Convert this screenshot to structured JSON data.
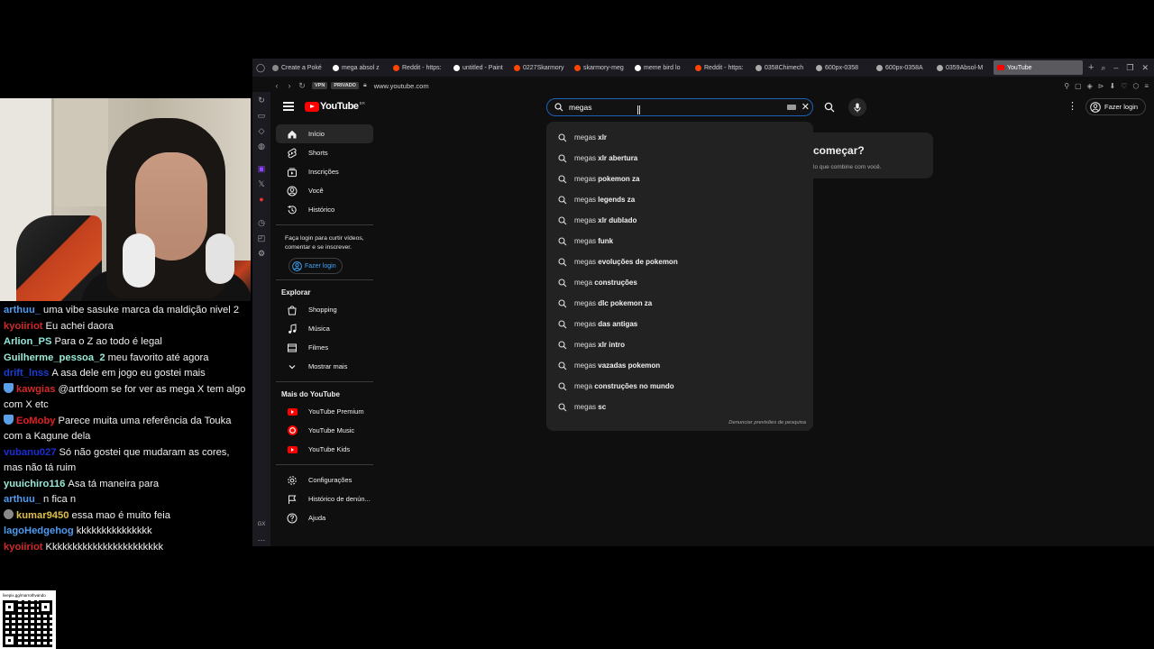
{
  "chat": {
    "partial_top": "",
    "messages": [
      {
        "user": "arthuu_",
        "color": "#4e9bf0",
        "text": "uma vibe sasuke marca da maldição nivel 2",
        "badge": ""
      },
      {
        "user": "kyoiiriot",
        "color": "#d02a2a",
        "text": "Eu achei daora",
        "badge": ""
      },
      {
        "user": "Arlion_PS",
        "color": "#8fe5d8",
        "text": "Para o Z ao todo é legal",
        "badge": ""
      },
      {
        "user": "Guilherme_pessoa_2",
        "color": "#9be9d6",
        "text": "meu favorito até agora",
        "badge": ""
      },
      {
        "user": "drift_lnss",
        "color": "#1a3ed6",
        "text": "A asa dele em jogo eu gostei mais",
        "badge": ""
      },
      {
        "user": "kawgias",
        "color": "#d02a2a",
        "text": "@artfdoom se for ver as mega X tem algo com X etc",
        "badge": "shield"
      },
      {
        "user": "EoMoby",
        "color": "#e02020",
        "text": "Parece muita uma referência da Touka com a Kagune dela",
        "badge": "shield"
      },
      {
        "user": "vubanu027",
        "color": "#1a2fd6",
        "text": "Só não gostei que mudaram as cores, mas não tá ruim",
        "badge": ""
      },
      {
        "user": "yuuichiro116",
        "color": "#9be9d6",
        "text": "Asa tá maneira para",
        "badge": ""
      },
      {
        "user": "arthuu_",
        "color": "#4e9bf0",
        "text": "n fica n",
        "badge": ""
      },
      {
        "user": "kumar9450",
        "color": "#e0c04a",
        "text": "essa mao é muito feia",
        "badge": "avatar"
      },
      {
        "user": "lagoHedgehog",
        "color": "#4e9bf0",
        "text": "kkkkkkkkkkkkkkk",
        "badge": ""
      },
      {
        "user": "kyoiiriot",
        "color": "#d02a2a",
        "text": "Kkkkkkkkkkkkkkkkkkkkkkk",
        "badge": ""
      }
    ],
    "qr_url": "livepix.gg/marrothvando"
  },
  "browser": {
    "tabs": [
      {
        "label": "Create a Poké",
        "icon": "page-icon",
        "color": "#888888"
      },
      {
        "label": "mega absol z",
        "icon": "google-icon",
        "color": "#ffffff"
      },
      {
        "label": "Reddit - https:",
        "icon": "reddit-icon",
        "color": "#ff4500"
      },
      {
        "label": "untitled - Paint",
        "icon": "paint-icon",
        "color": "#ffffff"
      },
      {
        "label": "0227Skarmory",
        "icon": "pokeball-icon",
        "color": "#ff4500"
      },
      {
        "label": "skarmory-meg",
        "icon": "pokeball-icon",
        "color": "#ff4500"
      },
      {
        "label": "meme bird lo",
        "icon": "google-icon",
        "color": "#ffffff"
      },
      {
        "label": "Reddit - https:",
        "icon": "reddit-icon",
        "color": "#ff4500"
      },
      {
        "label": "0358Chimech",
        "icon": "settings-icon",
        "color": "#aaaaaa"
      },
      {
        "label": "600px-0358",
        "icon": "settings-icon",
        "color": "#aaaaaa"
      },
      {
        "label": "600px-0358A",
        "icon": "settings-icon",
        "color": "#aaaaaa"
      },
      {
        "label": "0359Absol-M",
        "icon": "settings-icon",
        "color": "#aaaaaa"
      },
      {
        "label": "YouTube",
        "icon": "youtube-icon",
        "color": "#ff0000",
        "active": true
      }
    ],
    "vpn": "VPN",
    "private": "PRIVADO",
    "url": "www.youtube.com"
  },
  "youtube": {
    "logo": "YouTube",
    "logo_sup": "BR",
    "search_value": "megas",
    "login_label": "Fazer login",
    "guide": {
      "main": [
        {
          "label": "Início",
          "icon": "home-icon",
          "active": true
        },
        {
          "label": "Shorts",
          "icon": "shorts-icon"
        },
        {
          "label": "Inscrições",
          "icon": "subscriptions-icon"
        },
        {
          "label": "Você",
          "icon": "you-icon"
        },
        {
          "label": "Histórico",
          "icon": "history-icon"
        }
      ],
      "login_text": "Faça login para curtir vídeos, comentar e se inscrever.",
      "login_button": "Fazer login",
      "explore_title": "Explorar",
      "explore": [
        {
          "label": "Shopping",
          "icon": "shopping-icon"
        },
        {
          "label": "Música",
          "icon": "music-icon"
        },
        {
          "label": "Filmes",
          "icon": "movies-icon"
        },
        {
          "label": "Mostrar mais",
          "icon": "chevron-down-icon"
        }
      ],
      "more_title": "Mais do YouTube",
      "more": [
        {
          "label": "YouTube Premium",
          "icon": "youtube-premium-icon"
        },
        {
          "label": "YouTube Music",
          "icon": "youtube-music-icon"
        },
        {
          "label": "YouTube Kids",
          "icon": "youtube-kids-icon"
        }
      ],
      "footer": [
        {
          "label": "Configurações",
          "icon": "gear-icon"
        },
        {
          "label": "Histórico de denún...",
          "icon": "flag-icon"
        },
        {
          "label": "Ajuda",
          "icon": "help-icon"
        }
      ]
    },
    "suggestions": [
      {
        "q": "megas",
        "rest": " xlr"
      },
      {
        "q": "megas",
        "rest": " xlr abertura"
      },
      {
        "q": "megas",
        "rest": " pokemon za"
      },
      {
        "q": "megas",
        "rest": " legends za"
      },
      {
        "q": "megas",
        "rest": " xlr dublado"
      },
      {
        "q": "megas",
        "rest": " funk"
      },
      {
        "q": "megas",
        "rest": " evoluções de pokemon"
      },
      {
        "q": "mega",
        "rest": " construções"
      },
      {
        "q": "megas",
        "rest": " dlc pokemon za"
      },
      {
        "q": "megas",
        "rest": " das antigas"
      },
      {
        "q": "megas",
        "rest": " xlr intro"
      },
      {
        "q": "megas",
        "rest": " vazadas pokemon"
      },
      {
        "q": "mega",
        "rest": " construções no mundo"
      },
      {
        "q": "megas",
        "rest": " sc"
      }
    ],
    "report_label": "Denunciar previsões de pesquisa",
    "start_title": "começar?",
    "start_sub": "lo que combine com você."
  },
  "colors": {
    "brand_red": "#ff0000",
    "focus_blue": "#1c62b9",
    "link_blue": "#3ea6ff",
    "bg": "#0f0f0f"
  }
}
